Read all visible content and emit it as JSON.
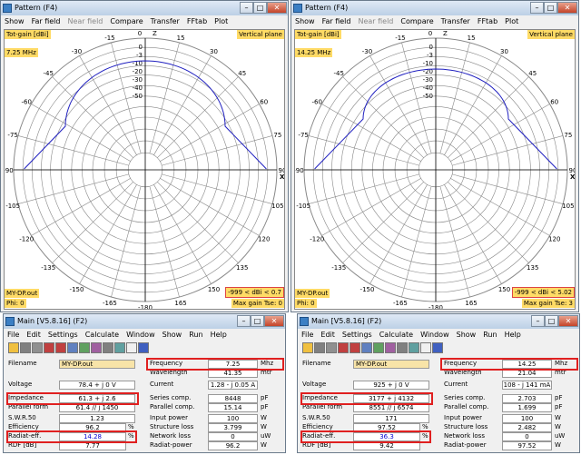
{
  "windows": {
    "pattern_left": {
      "title": "Pattern   (F4)",
      "menu": [
        "Show",
        "Far field",
        "Near field",
        "Compare",
        "Transfer",
        "FFtab",
        "Plot"
      ],
      "y_label": "Tot-gain [dBi]",
      "plane_label": "Vertical plane",
      "frequency": "7.25 MHz",
      "file": "MY-DP.out",
      "phi": "Phi: 0",
      "dbi_range": "-999 < dBi < 0.7",
      "max_gain": "Max gain Tse: 0"
    },
    "pattern_right": {
      "title": "Pattern   (F4)",
      "menu": [
        "Show",
        "Far field",
        "Near field",
        "Compare",
        "Transfer",
        "FFtab",
        "Plot"
      ],
      "y_label": "Tot-gain [dBi]",
      "plane_label": "Vertical plane",
      "frequency": "14.25 MHz",
      "file": "MY-DP.out",
      "phi": "Phi: 0",
      "dbi_range": "-999 < dBi < 5.02",
      "max_gain": "Max gain Tse: 3"
    },
    "main_left": {
      "title": "Main [V5.8.16]   (F2)",
      "menu": [
        "File",
        "Edit",
        "Settings",
        "Calculate",
        "Window",
        "Show",
        "Run",
        "Help"
      ],
      "filename_label": "Filename",
      "filename": "MY-DP.out",
      "frequency_label": "Frequency",
      "frequency": "7.25",
      "frequency_unit": "Mhz",
      "wavelength_label": "Wavelength",
      "wavelength": "41.35",
      "wavelength_unit": "mtr",
      "voltage_label": "Voltage",
      "voltage": "78.4 + j 0 V",
      "current_label": "Current",
      "current": "1.28 - j 0.05 A",
      "impedance_label": "Impedance",
      "impedance": "61.3 + j 2.6",
      "series_comp_label": "Series comp.",
      "series_comp": "8448",
      "series_comp_unit": "pF",
      "parallel_form_label": "Parallel form",
      "parallel_form": "61.4 // j 1450",
      "parallel_comp_label": "Parallel comp.",
      "parallel_comp": "15.14",
      "parallel_comp_unit": "pF",
      "swr_label": "S.W.R.50",
      "swr": "1.23",
      "input_power_label": "Input power",
      "input_power": "100",
      "input_power_unit": "W",
      "efficiency_label": "Efficiency",
      "efficiency": "96.2",
      "efficiency_unit": "%",
      "structure_loss_label": "Structure loss",
      "structure_loss": "3.799",
      "structure_loss_unit": "W",
      "radiat_eff_label": "Radiat-eff.",
      "radiat_eff": "14.28",
      "radiat_eff_unit": "%",
      "network_loss_label": "Network loss",
      "network_loss": "0",
      "network_loss_unit": "uW",
      "rdf_label": "RDF [dB]",
      "rdf": "7.77",
      "radiat_power_label": "Radiat-power",
      "radiat_power": "96.2",
      "radiat_power_unit": "W"
    },
    "main_right": {
      "title": "Main [V5.8.16]   (F2)",
      "menu": [
        "File",
        "Edit",
        "Settings",
        "Calculate",
        "Window",
        "Show",
        "Run",
        "Help"
      ],
      "filename_label": "Filename",
      "filename": "MY-DP.out",
      "frequency_label": "Frequency",
      "frequency": "14.25",
      "frequency_unit": "Mhz",
      "wavelength_label": "Wavelength",
      "wavelength": "21.04",
      "wavelength_unit": "mtr",
      "voltage_label": "Voltage",
      "voltage": "925 + j 0 V",
      "current_label": "Current",
      "current": "108 - j 141 mA",
      "impedance_label": "Impedance",
      "impedance": "3177 + j 4132",
      "series_comp_label": "Series comp.",
      "series_comp": "2.703",
      "series_comp_unit": "pF",
      "parallel_form_label": "Parallel form",
      "parallel_form": "8551 // j 6574",
      "parallel_comp_label": "Parallel comp.",
      "parallel_comp": "1.699",
      "parallel_comp_unit": "pF",
      "swr_label": "S.W.R.50",
      "swr": "171",
      "input_power_label": "Input power",
      "input_power": "100",
      "input_power_unit": "W",
      "efficiency_label": "Efficiency",
      "efficiency": "97.52",
      "efficiency_unit": "%",
      "structure_loss_label": "Structure loss",
      "structure_loss": "2.482",
      "structure_loss_unit": "W",
      "radiat_eff_label": "Radiat-eff.",
      "radiat_eff": "36.3",
      "radiat_eff_unit": "%",
      "network_loss_label": "Network loss",
      "network_loss": "0",
      "network_loss_unit": "uW",
      "rdf_label": "RDF [dB]",
      "rdf": "9.42",
      "radiat_power_label": "Radiat-power",
      "radiat_power": "97.52",
      "radiat_power_unit": "W"
    }
  },
  "polar": {
    "angle_labels": [
      "0",
      "-15",
      "15",
      "-30",
      "30",
      "-45",
      "45",
      "-60",
      "60",
      "-75",
      "75",
      "-90",
      "90",
      "-105",
      "105",
      "-120",
      "120",
      "-135",
      "135",
      "-150",
      "150",
      "-165",
      "165",
      "-180"
    ],
    "ring_labels": [
      "0",
      "-3",
      "-10",
      "-20",
      "-30",
      "-40",
      "-50"
    ],
    "z_label": "Z",
    "xy_label": "XY"
  },
  "colors": {
    "accent": "#ffdb66",
    "pattern": "#2020c0",
    "highlight": "#e02020"
  },
  "icons": [
    "folder-icon",
    "save-icon",
    "print-icon",
    "3d-icon",
    "2d-icon",
    "refresh-icon",
    "geometry-icon",
    "current-icon",
    "pattern-icon",
    "settings-icon",
    "ffk-icon",
    "help-icon"
  ]
}
